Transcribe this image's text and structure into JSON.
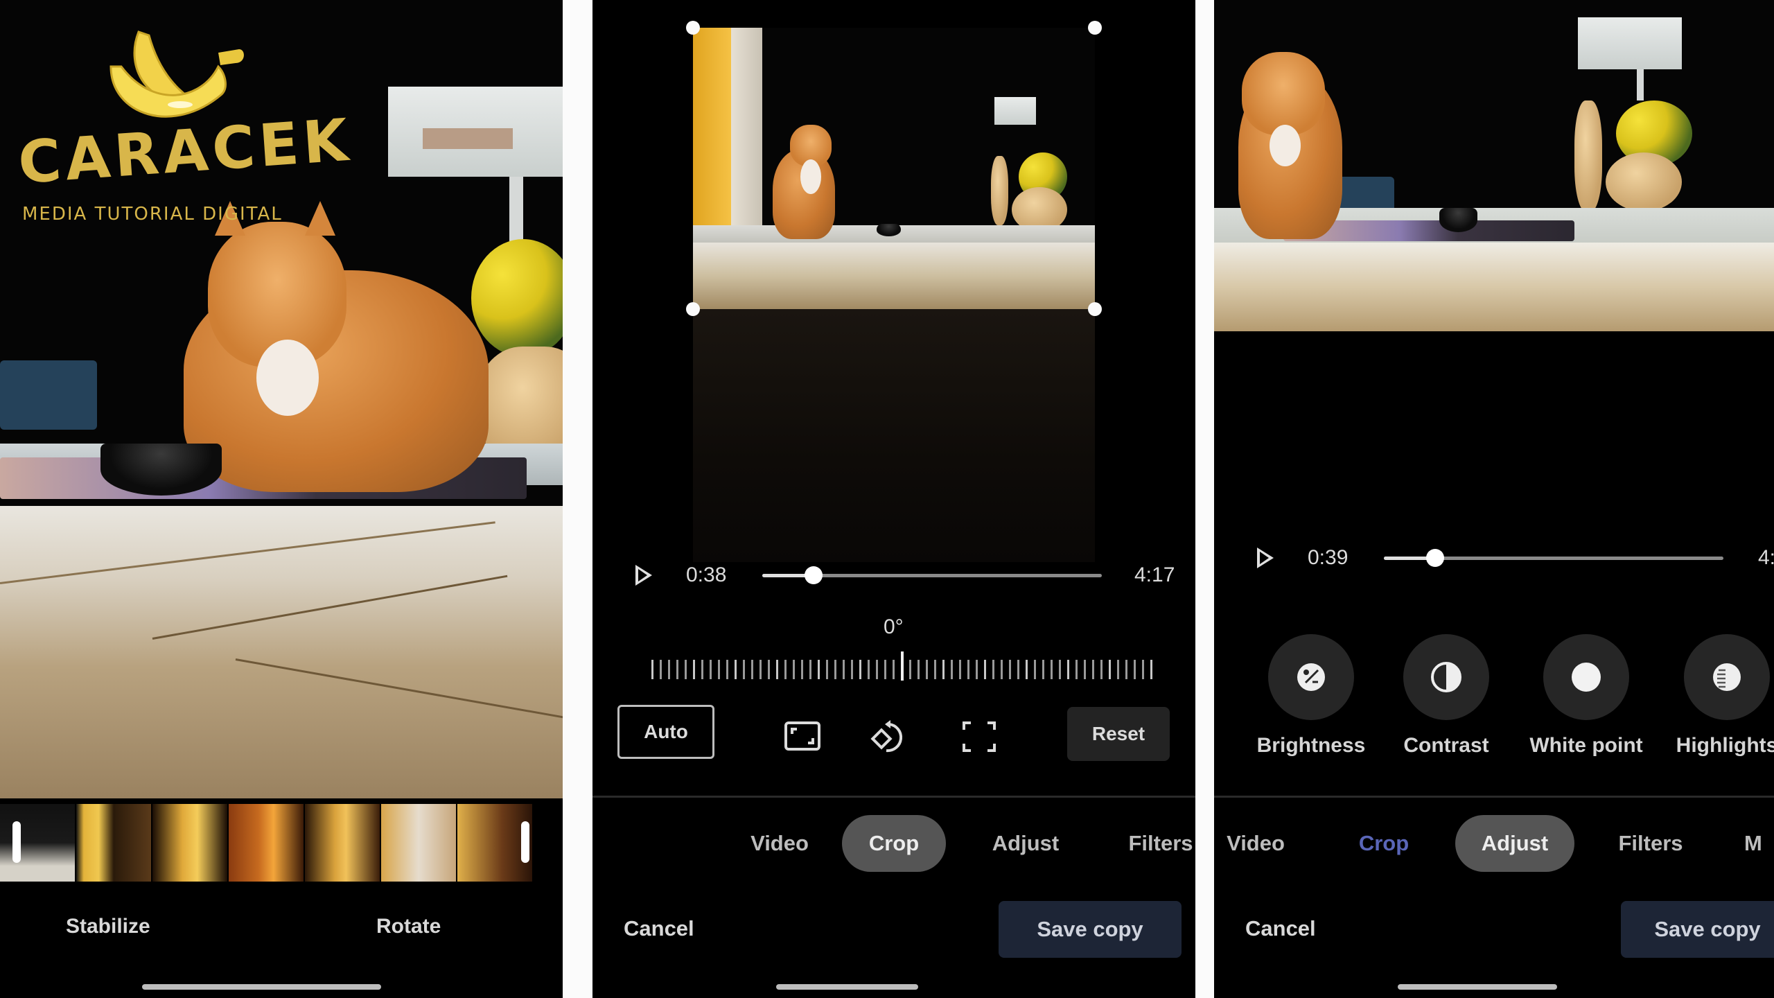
{
  "watermark": {
    "brand": "CARACEK",
    "tagline": "MEDIA TUTORIAL DIGITAL",
    "icon": "banana-icon",
    "color": "#d8b64a"
  },
  "panel1": {
    "screen": "video-trim-editor",
    "options": [
      "Stabilize",
      "Rotate"
    ],
    "filmstrip_frames": 7
  },
  "panel2": {
    "screen": "crop-editor",
    "playback": {
      "current": "0:38",
      "total": "4:17",
      "progress": 0.15
    },
    "rotation": {
      "label": "0°",
      "value_degrees": 0
    },
    "toolbar": {
      "auto_label": "Auto",
      "icons": [
        "aspect-ratio-icon",
        "rotate-icon",
        "free-crop-icon"
      ],
      "reset_label": "Reset"
    },
    "tabs": [
      {
        "label": "Video",
        "state": "normal"
      },
      {
        "label": "Crop",
        "state": "active"
      },
      {
        "label": "Adjust",
        "state": "normal"
      },
      {
        "label": "Filters",
        "state": "normal"
      }
    ],
    "cancel_label": "Cancel",
    "save_label": "Save copy"
  },
  "panel3": {
    "screen": "adjust-editor",
    "playback": {
      "current": "0:39",
      "total": "4:",
      "progress": 0.15
    },
    "adjust_tools": [
      {
        "label": "Brightness",
        "icon": "brightness-icon"
      },
      {
        "label": "Contrast",
        "icon": "contrast-icon"
      },
      {
        "label": "White point",
        "icon": "white-point-icon"
      },
      {
        "label": "Highlights",
        "icon": "highlights-icon"
      }
    ],
    "tabs": [
      {
        "label": "Video",
        "state": "normal"
      },
      {
        "label": "Crop",
        "state": "visited"
      },
      {
        "label": "Adjust",
        "state": "active"
      },
      {
        "label": "Filters",
        "state": "normal"
      },
      {
        "label": "M",
        "state": "normal"
      }
    ],
    "cancel_label": "Cancel",
    "save_label": "Save copy"
  },
  "colors": {
    "background": "#000000",
    "active_tab_pill": "#555555",
    "visited_tab_text": "#5a66b8",
    "save_button": "#1d2536",
    "tool_circle": "#262626"
  }
}
